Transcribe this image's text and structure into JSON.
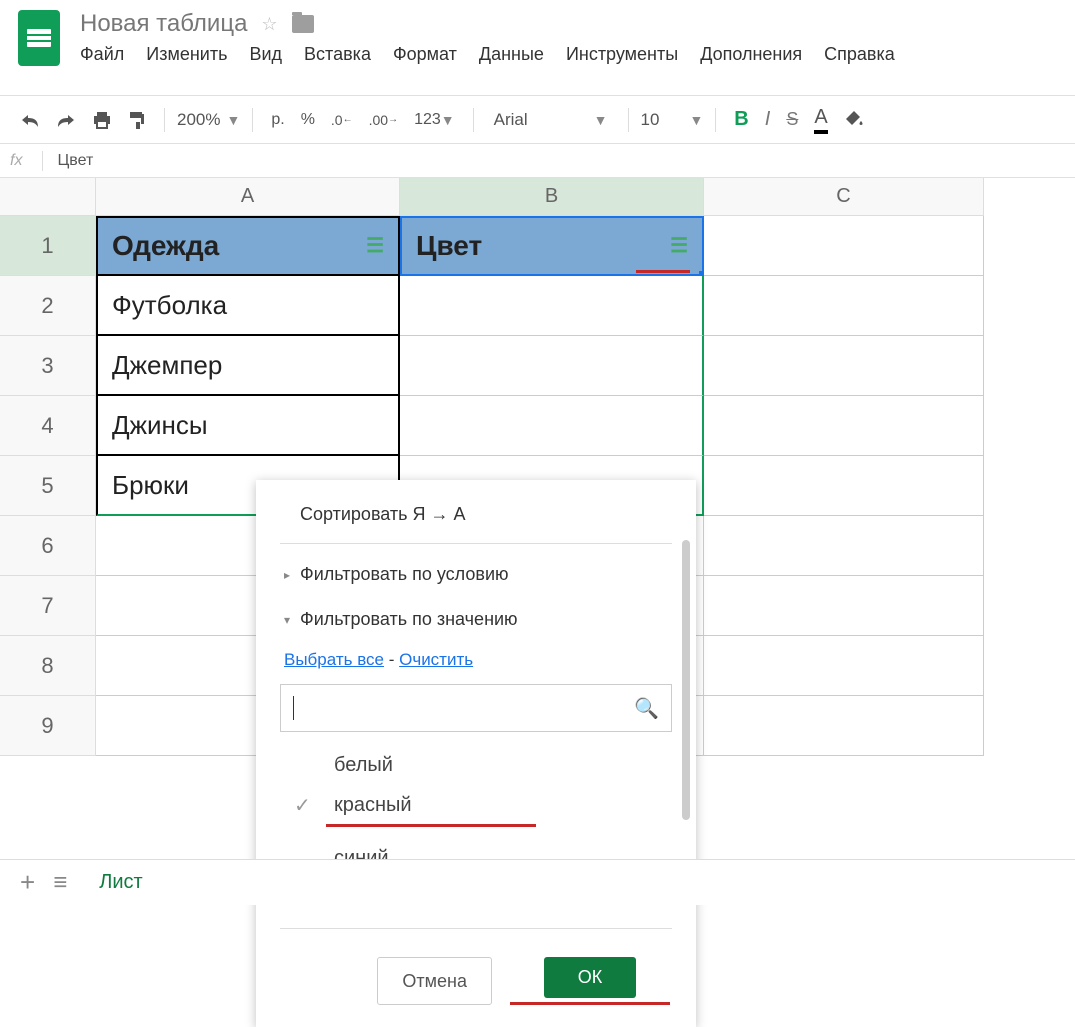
{
  "doc_title": "Новая таблица",
  "menubar": {
    "file": "Файл",
    "edit": "Изменить",
    "view": "Вид",
    "insert": "Вставка",
    "format": "Формат",
    "data": "Данные",
    "tools": "Инструменты",
    "addons": "Дополнения",
    "help": "Справка"
  },
  "toolbar": {
    "zoom": "200%",
    "currency": "р.",
    "pct": "%",
    "dec_dec": ".0",
    "inc_dec": ".00",
    "num_fmt": "123",
    "font": "Arial",
    "size": "10",
    "bold": "B",
    "italic": "I",
    "strike": "S",
    "text_color": "A"
  },
  "formula": {
    "fx": "fx",
    "value": "Цвет"
  },
  "columns": {
    "A": "A",
    "B": "B",
    "C": "C"
  },
  "rows": [
    "1",
    "2",
    "3",
    "4",
    "5",
    "6",
    "7",
    "8",
    "9"
  ],
  "headers": {
    "A": "Одежда",
    "B": "Цвет"
  },
  "dataA": [
    "Футболка",
    "Джемпер",
    "Джинсы",
    "Брюки"
  ],
  "popup": {
    "sort": "Сортировать Я → А",
    "by_condition": "Фильтровать по условию",
    "by_value": "Фильтровать по значению",
    "select_all": "Выбрать все",
    "clear": "Очистить",
    "values": {
      "v1": "белый",
      "v2": "красный",
      "v3": "синий"
    },
    "cancel": "Отмена",
    "ok": "ОК"
  },
  "sheetbar": {
    "sheet1": "Лист"
  },
  "glyphs": {
    "dash": " - ",
    "check": "✓",
    "plus": "+",
    "menu": "≡",
    "tri_right": "▸",
    "tri_down": "▾",
    "caret": "▼"
  }
}
